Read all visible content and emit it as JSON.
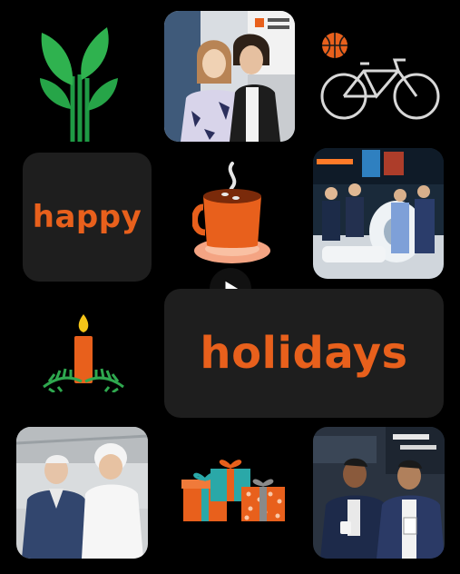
{
  "tiles": {
    "happy_label": "happy",
    "holidays_label": "holidays"
  },
  "icons": {
    "plant": "plant-icon",
    "basketball": "basketball-icon",
    "bicycle": "bicycle-icon",
    "coffee": "coffee-cup-icon",
    "candle": "candle-icon",
    "gifts": "gift-boxes-icon",
    "play": "play-icon"
  },
  "photos": [
    {
      "name": "photo-two-women-booth"
    },
    {
      "name": "photo-team-scanner"
    },
    {
      "name": "photo-two-men-factory"
    },
    {
      "name": "photo-two-men-expo"
    }
  ],
  "colors": {
    "accent": "#e8601c",
    "tile_bg": "#1e1e1e",
    "green": "#2fa84f",
    "background": "#000000"
  }
}
